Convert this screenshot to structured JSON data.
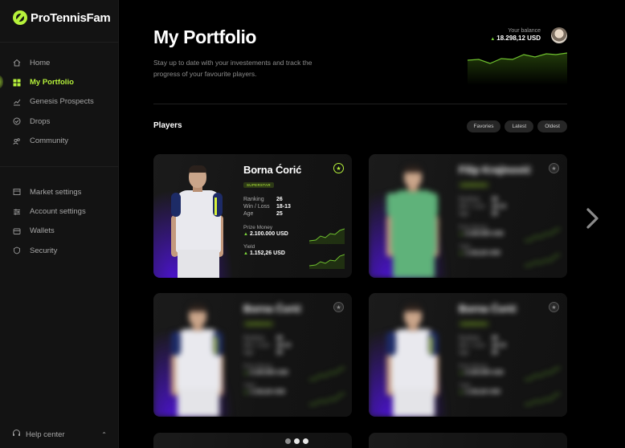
{
  "app": {
    "name": "ProTennisFam"
  },
  "sidebar": {
    "nav": [
      {
        "label": "Home",
        "icon": "home-icon",
        "active": false
      },
      {
        "label": "My Portfolio",
        "icon": "grid-icon",
        "active": true
      },
      {
        "label": "Genesis Prospects",
        "icon": "chart-icon",
        "active": false
      },
      {
        "label": "Drops",
        "icon": "check-circle-icon",
        "active": false
      },
      {
        "label": "Community",
        "icon": "community-icon",
        "active": false
      }
    ],
    "settings": [
      {
        "label": "Market settings",
        "icon": "calendar-icon"
      },
      {
        "label": "Account settings",
        "icon": "sliders-icon"
      },
      {
        "label": "Wallets",
        "icon": "wallet-icon"
      },
      {
        "label": "Security",
        "icon": "shield-icon"
      }
    ],
    "help": {
      "label": "Help center",
      "icon": "headset-icon"
    }
  },
  "header": {
    "title": "My Portfolio",
    "subtitle": "Stay up to date with your investements and track the progress of your favourite players.",
    "balance_label": "Your balance",
    "balance_value": "18.298,12 USD"
  },
  "players_section": {
    "title": "Players",
    "filters": [
      "Favories",
      "Latest",
      "Oldest"
    ]
  },
  "cards": [
    {
      "name": "Borna Ćorić",
      "badge": "SUPERSTAR",
      "ranking_label": "Ranking",
      "ranking": "26",
      "winloss_label": "Win / Loss",
      "winloss": "18-13",
      "age_label": "Age",
      "age": "25",
      "prize_label": "Prize Money",
      "prize": "2.100.000 USD",
      "yield_label": "Yield",
      "yield": "1.152,26 USD"
    },
    {
      "name": "Filip Krajinović",
      "badge": "SUPERSTAR",
      "ranking_label": "Ranking",
      "ranking": "26",
      "winloss_label": "Win / Loss",
      "winloss": "18-13",
      "age_label": "Age",
      "age": "25",
      "prize_label": "Prize Money",
      "prize": "2.100.000 USD",
      "yield_label": "Yield",
      "yield": "1.152,26 USD"
    },
    {
      "name": "Borna Ćorić",
      "badge": "SUPERSTAR",
      "ranking_label": "Ranking",
      "ranking": "26",
      "winloss_label": "Win / Loss",
      "winloss": "18-13",
      "age_label": "Age",
      "age": "25",
      "prize_label": "Prize Money",
      "prize": "2.100.000 USD",
      "yield_label": "Yield",
      "yield": "1.152,26 USD"
    },
    {
      "name": "Borna Ćorić",
      "badge": "SUPERSTAR",
      "ranking_label": "Ranking",
      "ranking": "26",
      "winloss_label": "Win / Loss",
      "winloss": "18-13",
      "age_label": "Age",
      "age": "25",
      "prize_label": "Prize Money",
      "prize": "2.100.000 USD",
      "yield_label": "Yield",
      "yield": "1.152,26 USD"
    }
  ],
  "colors": {
    "accent": "#b6f23b",
    "positive": "#7dd63a",
    "glow": "#4a14c9",
    "background": "#000000",
    "sidebar": "#131313"
  },
  "icons": {
    "next": "chevron-right-icon",
    "favorite": "star-icon",
    "up": "triangle-up-icon"
  }
}
